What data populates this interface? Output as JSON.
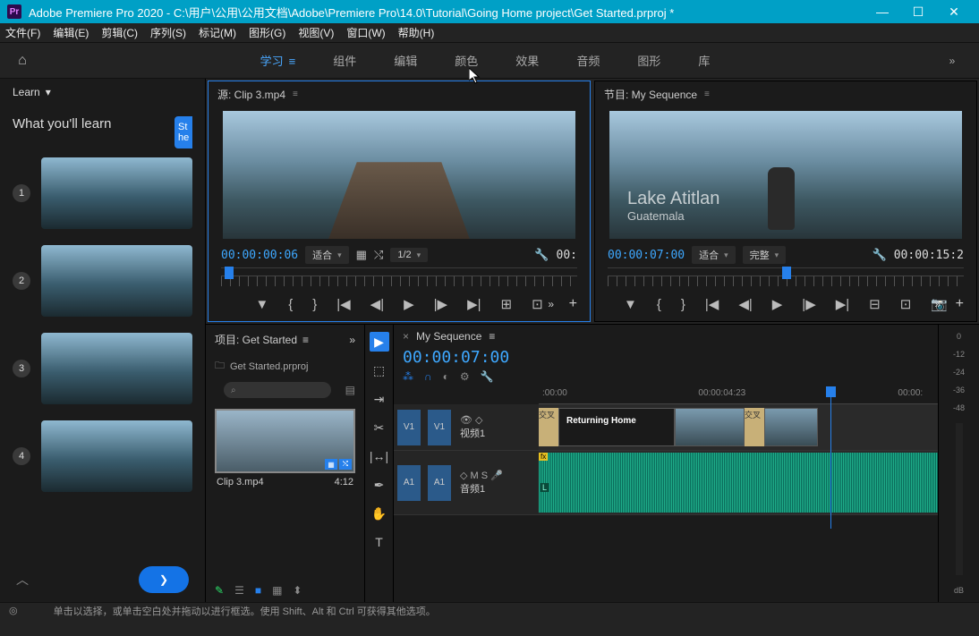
{
  "title": "Adobe Premiere Pro 2020 - C:\\用户\\公用\\公用文档\\Adobe\\Premiere Pro\\14.0\\Tutorial\\Going Home project\\Get Started.prproj *",
  "menu": [
    "文件(F)",
    "编辑(E)",
    "剪辑(C)",
    "序列(S)",
    "标记(M)",
    "图形(G)",
    "视图(V)",
    "窗口(W)",
    "帮助(H)"
  ],
  "workspaces": {
    "active": "学习",
    "items": [
      "学习",
      "组件",
      "编辑",
      "颜色",
      "效果",
      "音频",
      "图形",
      "库"
    ]
  },
  "learn": {
    "tab": "Learn",
    "header": "What you'll learn",
    "bubble": "St\nhe",
    "lessons": 4
  },
  "source": {
    "title": "源: Clip 3.mp4",
    "tc": "00:00:00:06",
    "zoom": "适合",
    "res": "1/2",
    "dur": "00:"
  },
  "program": {
    "title": "节目: My Sequence",
    "tc": "00:00:07:00",
    "zoom": "适合",
    "quality": "完整",
    "dur": "00:00:15:2",
    "overlay": {
      "l1": "Lake Atitlan",
      "l2": "Guatemala"
    }
  },
  "project": {
    "title": "项目: Get Started",
    "file": "Get Started.prproj",
    "clip": {
      "name": "Clip 3.mp4",
      "dur": "4:12"
    },
    "search": "⌕"
  },
  "timeline": {
    "tab": "My Sequence",
    "tc": "00:00:07:00",
    "ruler": [
      ":00:00",
      "00:00:04:23",
      "00:00:"
    ],
    "v1": {
      "patch": "V1",
      "name": "视频1"
    },
    "a1": {
      "patch": "A1",
      "name": "音频1",
      "controls": [
        "M",
        "S"
      ]
    },
    "title_clip": "Returning Home",
    "tan1": "交叉",
    "tan2": "交叉",
    "fx": "fx",
    "L": "L"
  },
  "meters": [
    "0",
    "-12",
    "-24",
    "-36",
    "-48",
    "dB"
  ],
  "status": {
    "tip": "单击以选择，或单击空白处并拖动以进行框选。使用 Shift、Alt 和 Ctrl 可获得其他选项。"
  }
}
